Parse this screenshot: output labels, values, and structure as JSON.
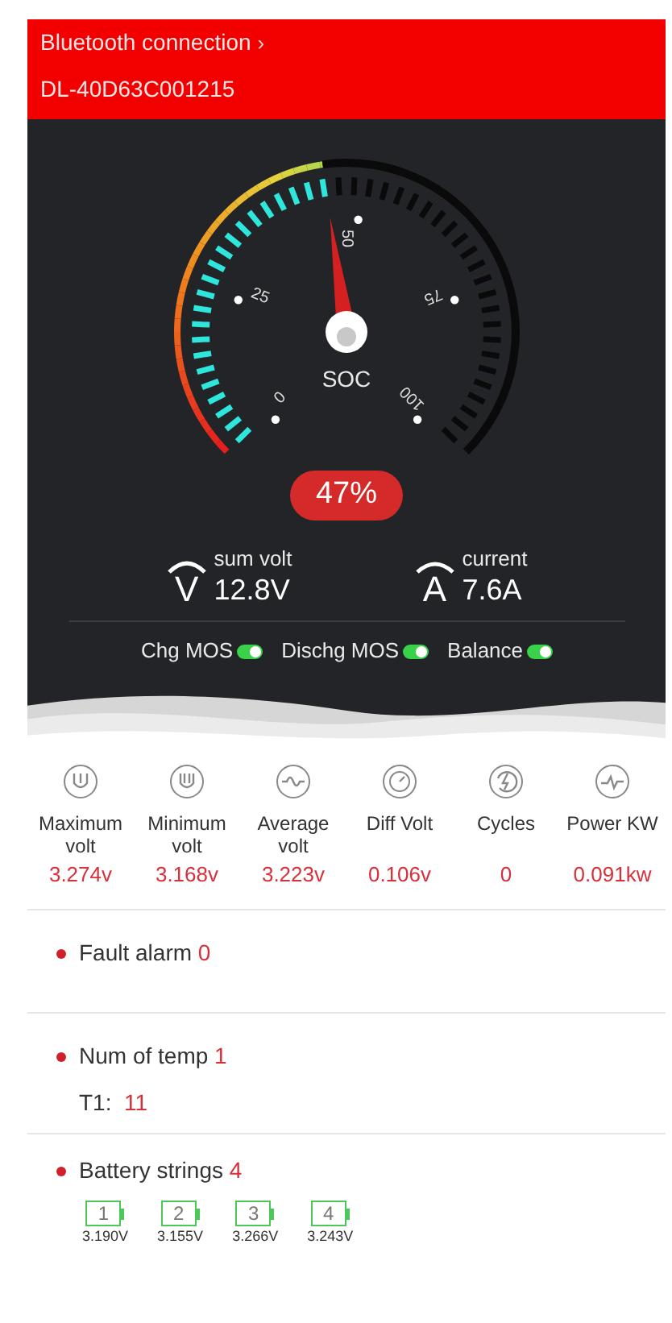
{
  "header": {
    "title": "Bluetooth connection",
    "arrow": "›",
    "device": "DL-40D63C001215"
  },
  "gauge": {
    "label": "SOC",
    "level": 0.47,
    "reading": "47%",
    "scale_labels": [
      "0",
      "25",
      "50",
      "75",
      "100"
    ]
  },
  "readings": [
    {
      "kind": "volt",
      "symbol": "V",
      "label": "sum volt",
      "value": "12.8V"
    },
    {
      "kind": "current",
      "symbol": "A",
      "label": "current",
      "value": "7.6A"
    }
  ],
  "switches": [
    {
      "label": "Chg MOS",
      "on": true
    },
    {
      "label": "Dischg MOS",
      "on": true
    },
    {
      "label": "Balance",
      "on": true
    }
  ],
  "stats": [
    {
      "kind": "max",
      "label": "Maximum volt",
      "value": "3.274v"
    },
    {
      "kind": "min",
      "label": "Minimum volt",
      "value": "3.168v"
    },
    {
      "kind": "average",
      "label": "Average volt",
      "value": "3.223v"
    },
    {
      "kind": "diff",
      "label": "Diff Volt",
      "value": "0.106v"
    },
    {
      "kind": "cycles",
      "label": "Cycles",
      "value": "0"
    },
    {
      "kind": "power",
      "label": "Power KW",
      "value": "0.091kw"
    }
  ],
  "fault_alarm": {
    "label": "Fault alarm",
    "count": "0"
  },
  "temperature": {
    "label": "Num of temp",
    "count": "1",
    "sensors": [
      {
        "label": "T1:",
        "value": "11"
      }
    ]
  },
  "battery_strings": {
    "label": "Battery strings",
    "count": "4",
    "cells": [
      {
        "index": "1",
        "voltage": "3.190V"
      },
      {
        "index": "2",
        "voltage": "3.155V"
      },
      {
        "index": "3",
        "voltage": "3.266V"
      },
      {
        "index": "4",
        "voltage": "3.243V"
      }
    ]
  }
}
